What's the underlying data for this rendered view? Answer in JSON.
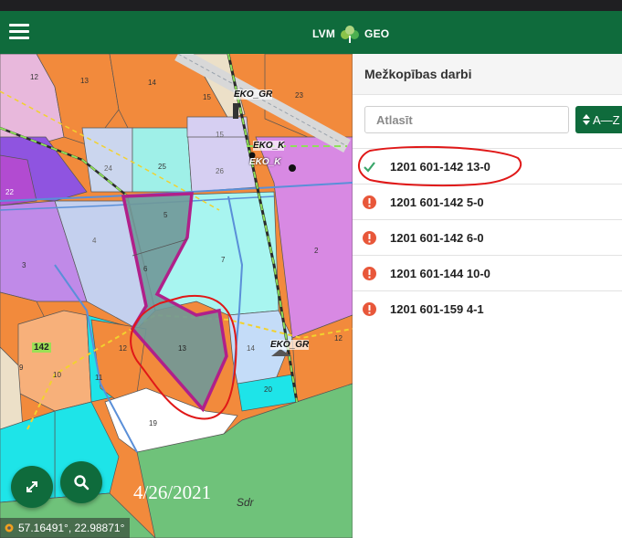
{
  "app": {
    "brand_left": "LVM",
    "brand_right": "GEO"
  },
  "map": {
    "parcel_numbers": [
      "12",
      "13",
      "14",
      "15",
      "23",
      "24",
      "25",
      "26",
      "22",
      "5",
      "4",
      "7",
      "6",
      "3",
      "2",
      "15",
      "142",
      "9",
      "10",
      "11",
      "12",
      "13",
      "14",
      "12",
      "20",
      "19"
    ],
    "labels": {
      "eko_gr_top": "EKO_GR",
      "eko_k_1": "EKO_K",
      "eko_k_2": "EKO_K",
      "eko_gr_right": "EKO_GR",
      "sdr": "Sdr"
    },
    "date_stamp": "4/26/2021",
    "coordinates": "57.16491°, 22.98871°"
  },
  "panel": {
    "title": "Mežkopības darbi",
    "search_placeholder": "Atlasīt",
    "sort_label": "A—Z",
    "items": [
      {
        "label": "1201 601-142 13-0",
        "status": "done"
      },
      {
        "label": "1201 601-142 5-0",
        "status": "warning"
      },
      {
        "label": "1201 601-142 6-0",
        "status": "warning"
      },
      {
        "label": "1201 601-144 10-0",
        "status": "warning"
      },
      {
        "label": "1201 601-159 4-1",
        "status": "warning"
      }
    ]
  },
  "colors": {
    "brand_green": "#0f6b3c",
    "warning_orange": "#e8573a",
    "check_green": "#3aa66a",
    "annotation_red": "#e01818",
    "selection_magenta": "#b0208a"
  }
}
